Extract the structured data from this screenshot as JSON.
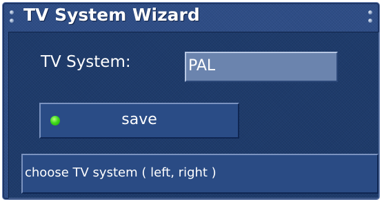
{
  "window": {
    "title": "TV System Wizard"
  },
  "form": {
    "tv_system_label": "TV System:",
    "tv_system_value": "PAL"
  },
  "actions": {
    "save_label": "save",
    "status_indicator_color": "#3fdc1c"
  },
  "help": {
    "text": "choose TV system ( left, right )"
  },
  "colors": {
    "window_bg": "#2e4d86",
    "panel_bg": "#1e3b6b",
    "field_bg": "#6b84ae",
    "text": "#ffffff"
  },
  "icons": {
    "corner_screws": "screw-icon",
    "status_dot": "green-dot-icon"
  }
}
